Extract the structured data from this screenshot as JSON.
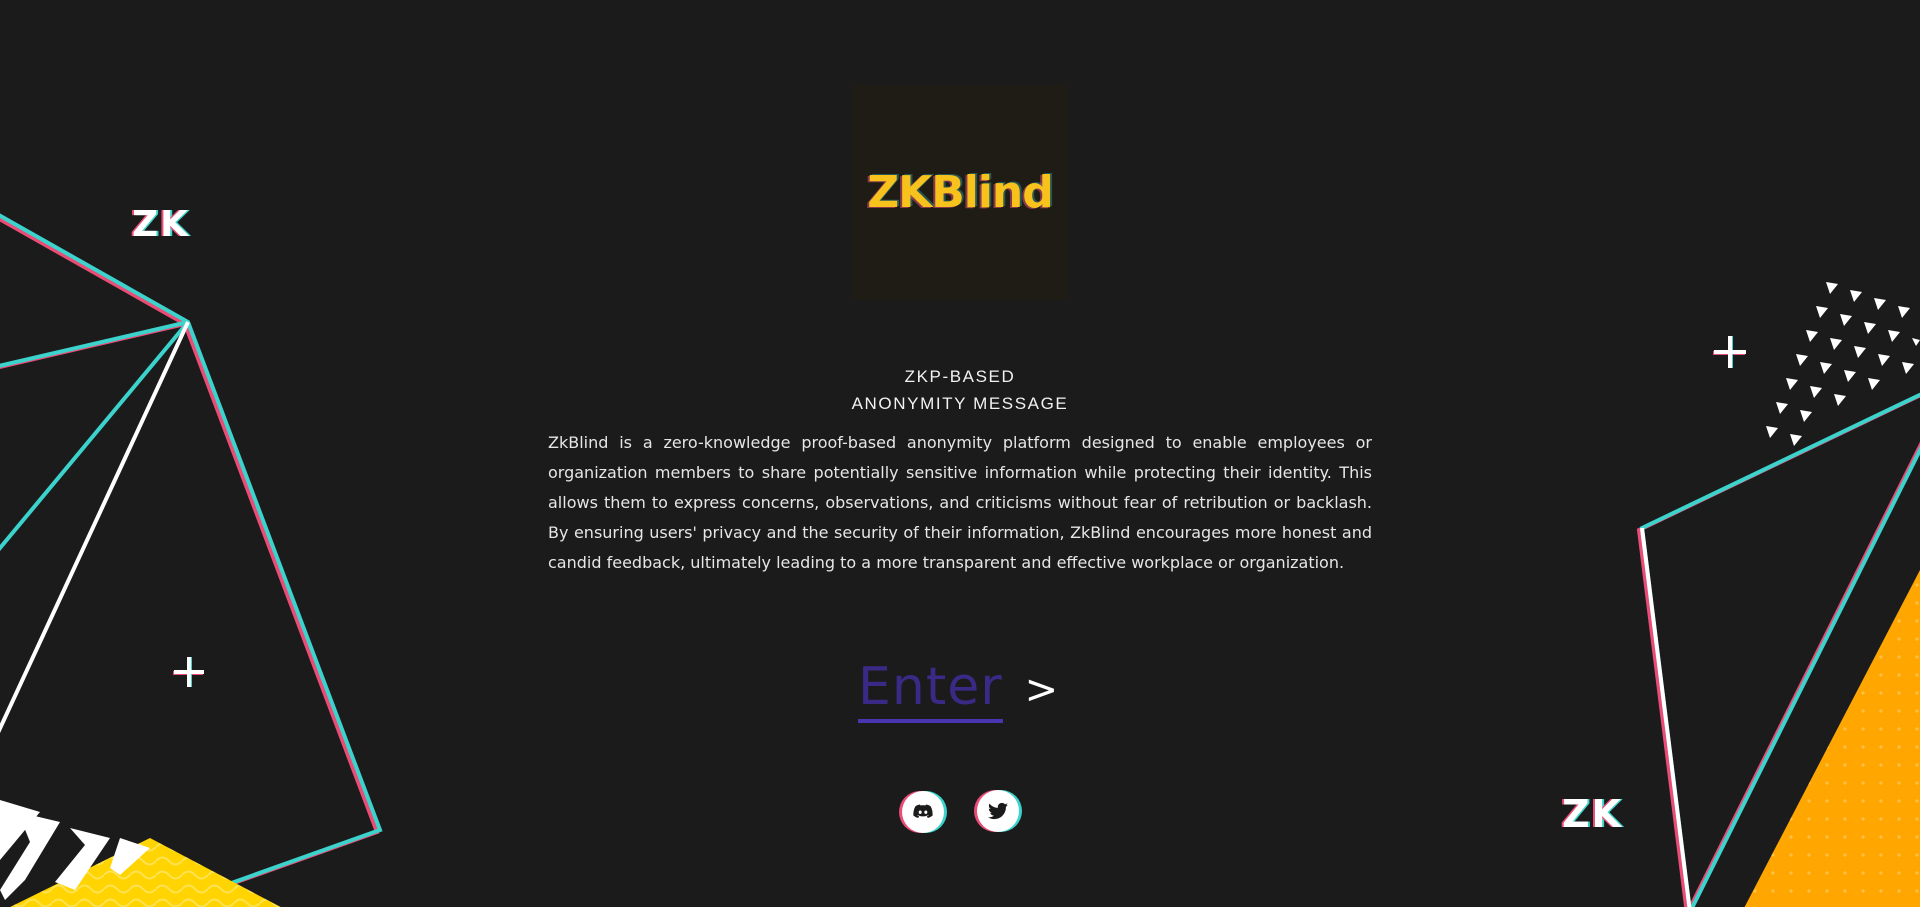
{
  "brand": {
    "logo_text": "ZKBlind"
  },
  "hero": {
    "subtitle_line1": "ZKP-BASED",
    "subtitle_line2": "ANONYMITY MESSAGE",
    "description": "ZkBlind is a zero-knowledge proof-based anonymity platform designed to enable employees or organization members to share potentially sensitive information while protecting their identity. This allows them to express concerns, observations, and criticisms without fear of retribution or backlash. By ensuring users' privacy and the security of their information, ZkBlind encourages more honest and candid feedback, ultimately leading to a more transparent and effective workplace or organization."
  },
  "cta": {
    "label": "Enter",
    "arrow": ">"
  },
  "social": [
    {
      "name": "discord",
      "icon": "discord-icon"
    },
    {
      "name": "twitter",
      "icon": "twitter-icon"
    }
  ],
  "decor": {
    "zk_left": "ZK",
    "zk_right": "ZK"
  },
  "colors": {
    "background": "#1b1b1b",
    "logo": "#f7c21c",
    "enter": "#3a2a86",
    "accent_pink": "#ea4c76",
    "accent_cyan": "#3bd3cc",
    "accent_yellow": "#ffd400",
    "accent_orange": "#ffa600"
  }
}
